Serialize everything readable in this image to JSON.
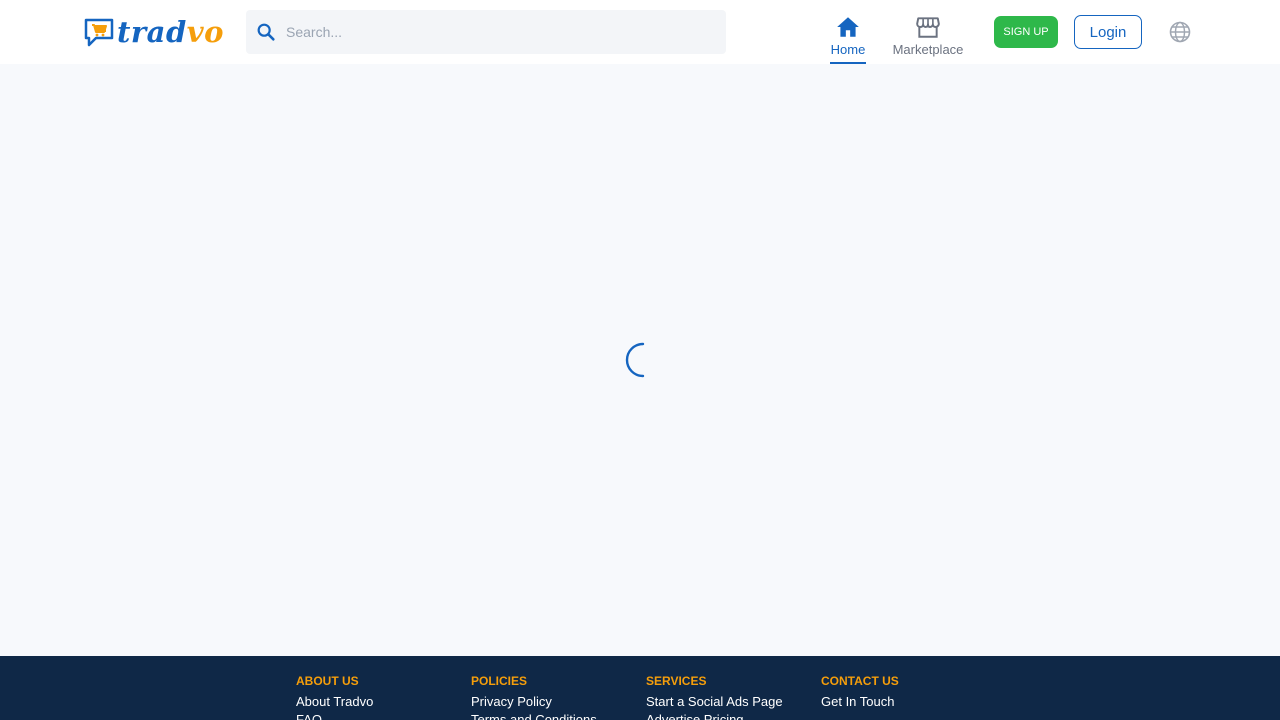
{
  "brand": {
    "name_part1": "trad",
    "name_part2": "vo",
    "colors": {
      "primary": "#1565c0",
      "accent": "#f59e0b",
      "signup": "#2eb84a",
      "footer_bg": "#0f2847"
    }
  },
  "header": {
    "search": {
      "placeholder": "Search...",
      "value": ""
    },
    "nav": [
      {
        "label": "Home",
        "icon": "home-icon",
        "active": true
      },
      {
        "label": "Marketplace",
        "icon": "storefront-icon",
        "active": false
      }
    ],
    "signup_label": "SIGN UP",
    "login_label": "Login",
    "language_icon": "globe-icon"
  },
  "main": {
    "loading": true,
    "indicator": "spinner-icon"
  },
  "footer": {
    "columns": [
      {
        "heading": "ABOUT US",
        "links": [
          "About Tradvo",
          "FAQ"
        ]
      },
      {
        "heading": "POLICIES",
        "links": [
          "Privacy Policy",
          "Terms and Conditions"
        ]
      },
      {
        "heading": "SERVICES",
        "links": [
          "Start a Social Ads Page",
          "Advertise Pricing"
        ]
      },
      {
        "heading": "CONTACT US",
        "links": [
          "Get In Touch"
        ]
      }
    ]
  }
}
